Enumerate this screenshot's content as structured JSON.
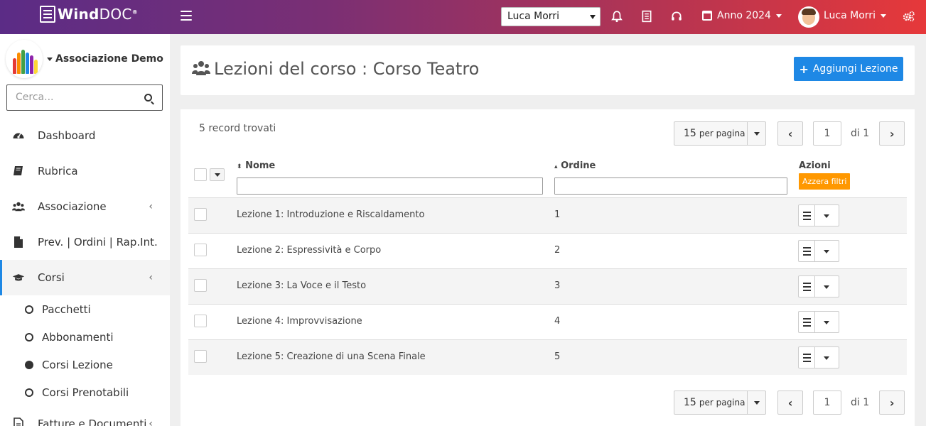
{
  "topbar": {
    "logo_wind": "Wind",
    "logo_doc": "DOC",
    "logo_reg": "®",
    "user_select_value": "Luca Morri",
    "year_label": "Anno 2024",
    "user_name": "Luca Morri"
  },
  "sidebar": {
    "org_name": "Associazione Demo",
    "search_placeholder": "Cerca...",
    "items": [
      {
        "label": "Dashboard",
        "icon": "dashboard-icon"
      },
      {
        "label": "Rubrica",
        "icon": "book-icon"
      },
      {
        "label": "Associazione",
        "icon": "users-icon",
        "chevron": "‹"
      },
      {
        "label": "Prev. | Ordini | Rap.Int.",
        "icon": "file-icon"
      },
      {
        "label": "Corsi",
        "icon": "graduation-cap-icon",
        "chevron": "‹"
      }
    ],
    "sub_items": [
      {
        "label": "Pacchetti",
        "selected": false
      },
      {
        "label": "Abbonamenti",
        "selected": false
      },
      {
        "label": "Corsi Lezione",
        "selected": true
      },
      {
        "label": "Corsi Prenotabili",
        "selected": false
      }
    ],
    "last_item": {
      "label": "Fatture e Documenti",
      "chevron": "‹"
    }
  },
  "header": {
    "title": "Lezioni del corso : Corso Teatro",
    "add_button": "Aggiungi Lezione"
  },
  "list": {
    "record_count": "5 record trovati",
    "per_page_value": "15",
    "per_page_suffix": "per pagina",
    "page": "1",
    "page_of": "di 1",
    "columns": {
      "nome": "Nome",
      "ordine": "Ordine",
      "azioni": "Azioni"
    },
    "reset_filters": "Azzera filtri",
    "rows": [
      {
        "nome": "Lezione 1: Introduzione e Riscaldamento",
        "ordine": "1"
      },
      {
        "nome": "Lezione 2: Espressività e Corpo",
        "ordine": "2"
      },
      {
        "nome": "Lezione 3: La Voce e il Testo",
        "ordine": "3"
      },
      {
        "nome": "Lezione 4: Improvvisazione",
        "ordine": "4"
      },
      {
        "nome": "Lezione 5: Creazione di una Scena Finale",
        "ordine": "5"
      }
    ]
  },
  "colors": {
    "accent": "#1e88e5",
    "reset_button": "#ff9800",
    "topbar_start": "#5b2c86",
    "topbar_end": "#e6383a"
  }
}
